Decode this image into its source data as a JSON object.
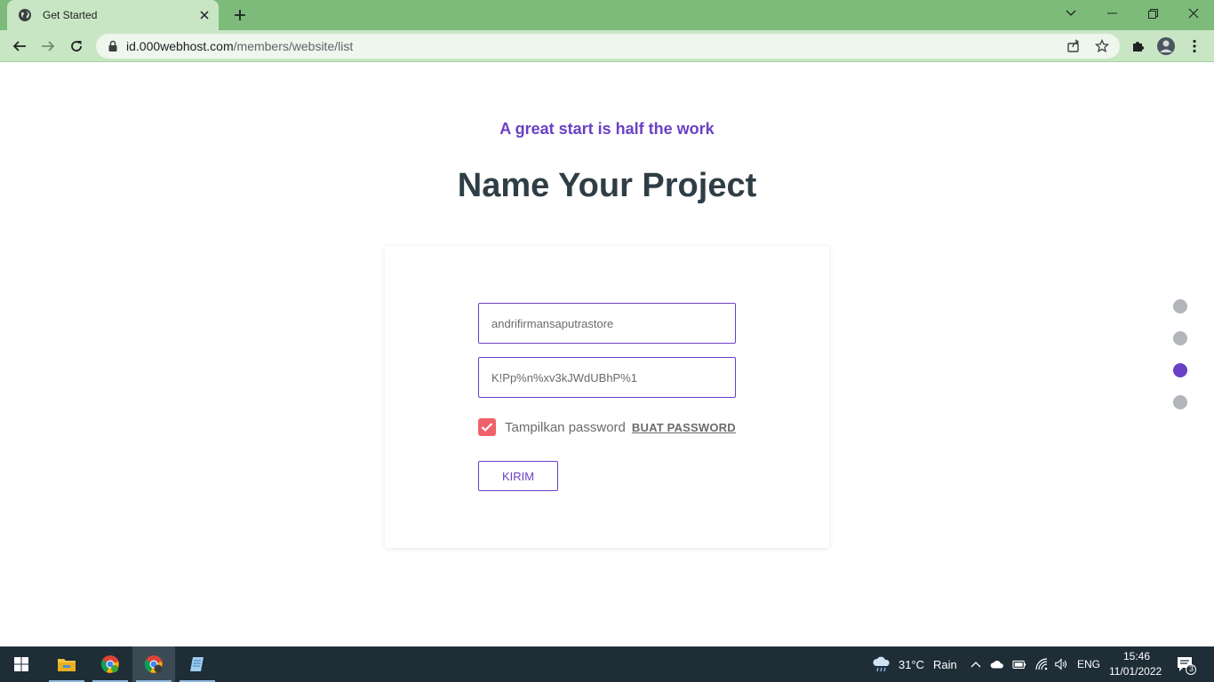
{
  "browser": {
    "tab_title": "Get Started",
    "url_host": "id.000webhost.com",
    "url_path": "/members/website/list"
  },
  "page": {
    "tagline": "A great start is half the work",
    "heading": "Name Your Project",
    "form": {
      "website_name_value": "andrifirmansaputrastore",
      "password_value": "K!Pp%n%xv3kJWdUBhP%1",
      "show_password_label": "Tampilkan password",
      "show_password_checked": true,
      "generate_password_label": "BUAT PASSWORD",
      "submit_label": "KIRIM"
    },
    "steps": {
      "total": 4,
      "active_index": 2
    }
  },
  "taskbar": {
    "apps": [
      "windows-start-icon",
      "file-explorer-icon",
      "chrome-icon",
      "chrome-profile-icon",
      "notepad-icon"
    ],
    "weather_temp": "31°C",
    "weather_desc": "Rain",
    "language": "ENG",
    "time": "15:46",
    "date": "11/01/2022",
    "notification_count": "3"
  },
  "colors": {
    "accent": "#6a40c5",
    "checkbox": "#f0626b",
    "chrome_frame": "#7dbb7a",
    "chrome_toolbar": "#c8e6c4"
  }
}
